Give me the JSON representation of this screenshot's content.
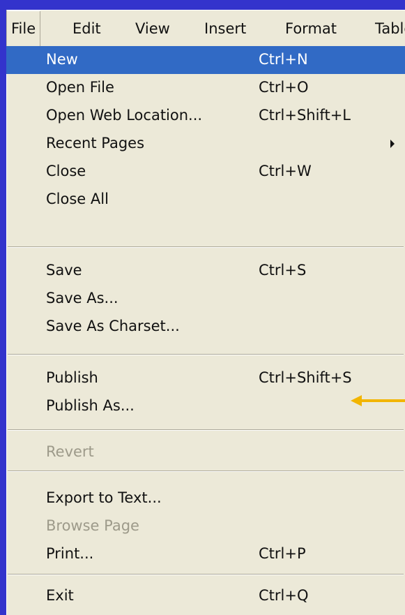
{
  "menubar": {
    "items": [
      {
        "label": "File"
      },
      {
        "label": "Edit"
      },
      {
        "label": "View"
      },
      {
        "label": "Insert"
      },
      {
        "label": "Format"
      },
      {
        "label": "Table"
      }
    ]
  },
  "file_menu": {
    "items": [
      {
        "label": "New",
        "shortcut": "Ctrl+N"
      },
      {
        "label": "Open File",
        "shortcut": "Ctrl+O"
      },
      {
        "label": "Open Web Location...",
        "shortcut": "Ctrl+Shift+L"
      },
      {
        "label": "Recent Pages",
        "shortcut": ""
      },
      {
        "label": "Close",
        "shortcut": "Ctrl+W"
      },
      {
        "label": "Close All",
        "shortcut": ""
      },
      {
        "label": "Save",
        "shortcut": "Ctrl+S"
      },
      {
        "label": "Save As...",
        "shortcut": ""
      },
      {
        "label": "Save As Charset...",
        "shortcut": ""
      },
      {
        "label": "Publish",
        "shortcut": "Ctrl+Shift+S"
      },
      {
        "label": "Publish As...",
        "shortcut": ""
      },
      {
        "label": "Revert",
        "shortcut": ""
      },
      {
        "label": "Export to Text...",
        "shortcut": ""
      },
      {
        "label": "Browse Page",
        "shortcut": ""
      },
      {
        "label": "Print...",
        "shortcut": "Ctrl+P"
      },
      {
        "label": "Exit",
        "shortcut": "Ctrl+Q"
      }
    ]
  },
  "colors": {
    "background": "#3333cc",
    "menu": "#ece9d8",
    "highlight": "#316ac5",
    "disabled_text": "#9d9a8a",
    "annotation_arrow": "#f2b500"
  },
  "annotation": {
    "icon": "arrow-left-icon"
  }
}
